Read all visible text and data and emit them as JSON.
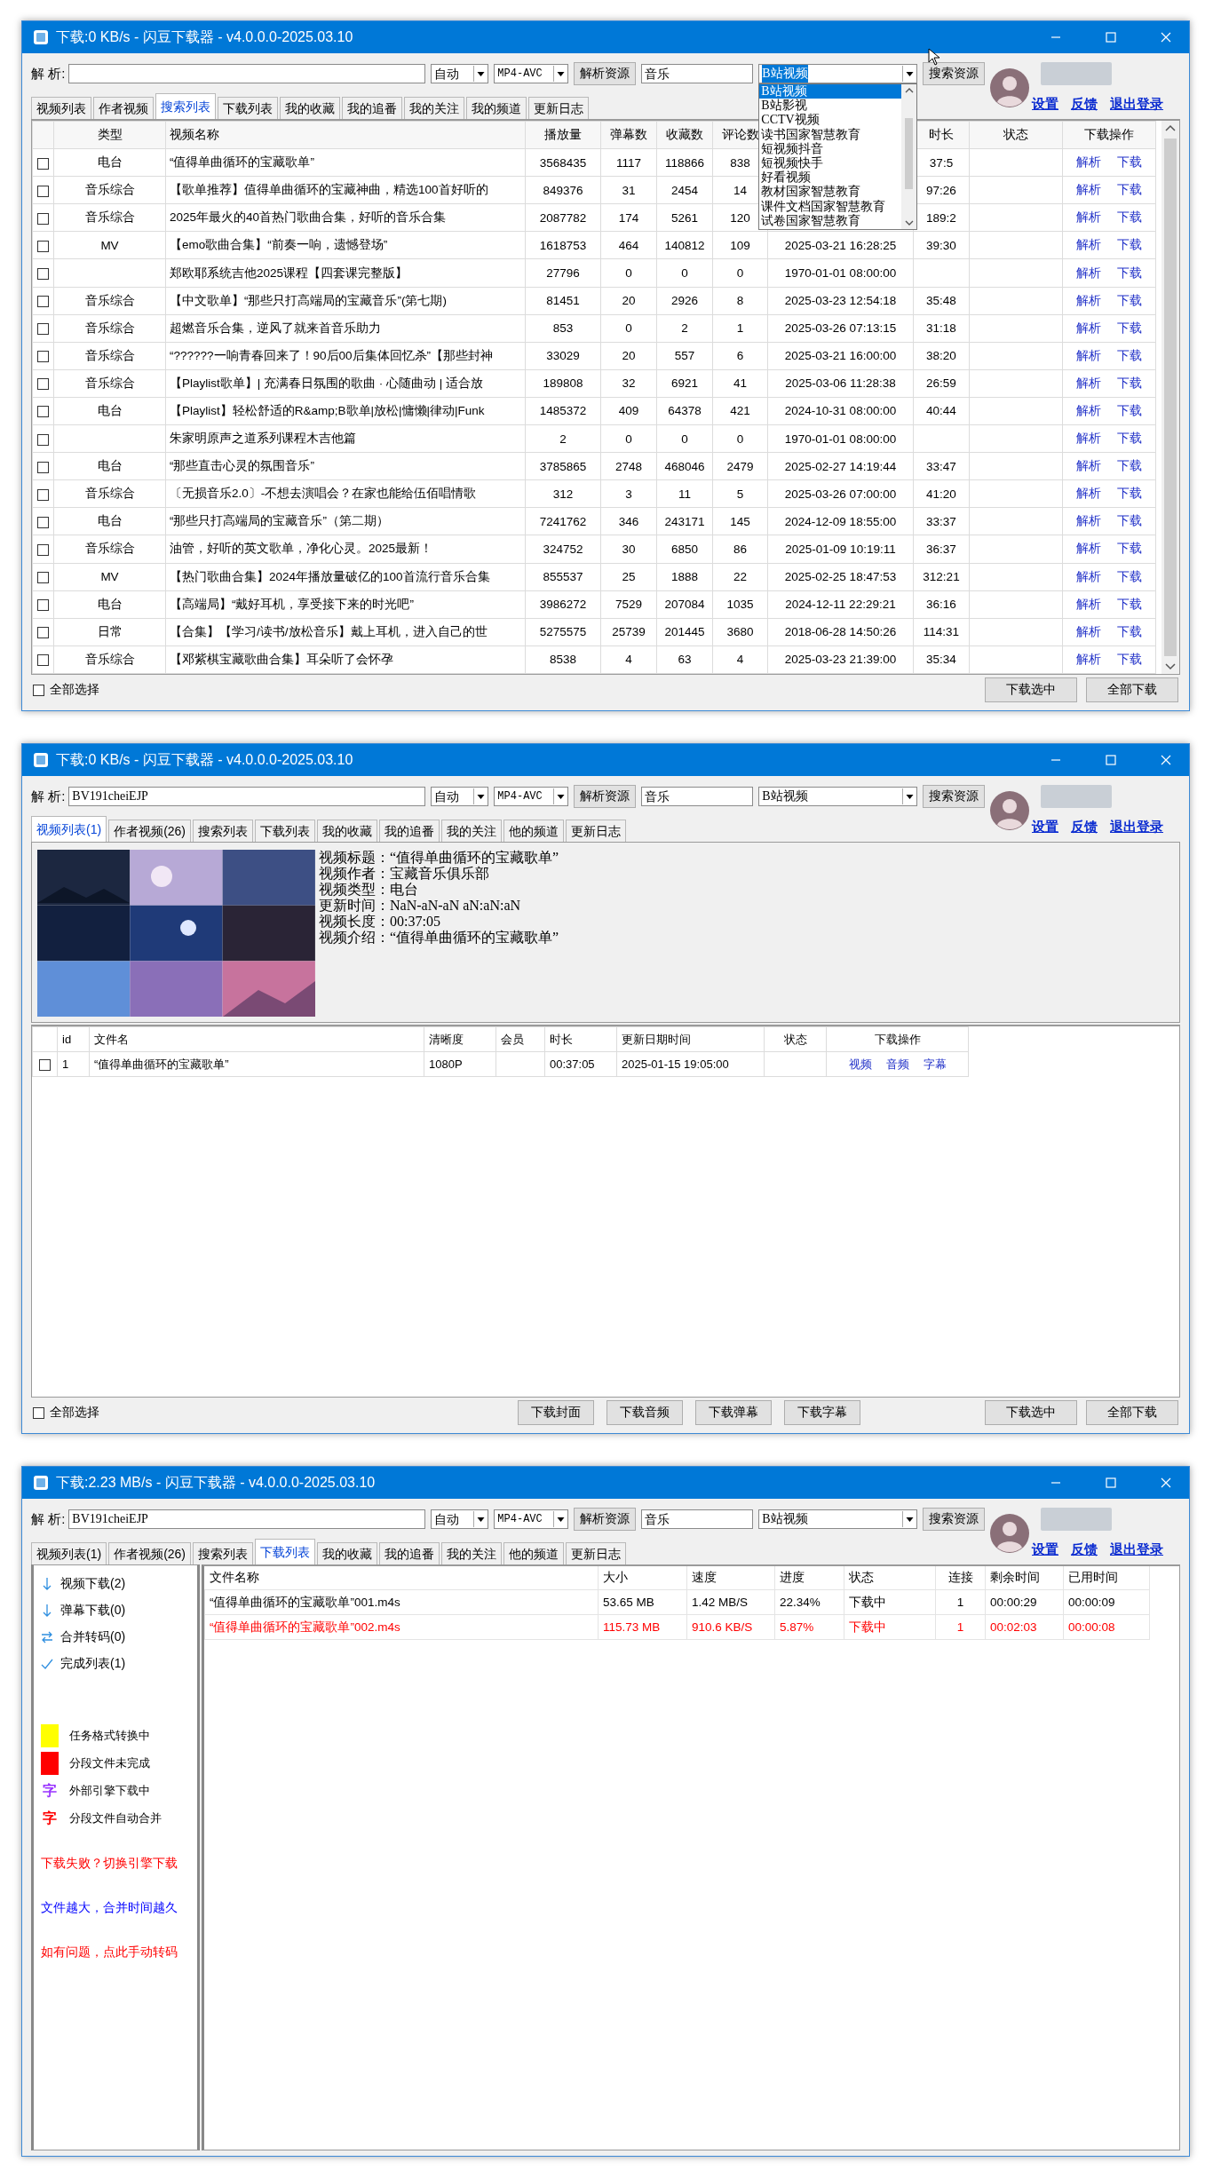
{
  "windows": [
    {
      "kind": "search",
      "title": "下载:0 KB/s - 闪豆下载器 - v4.0.0.0-2025.03.10",
      "toolbar": {
        "label": "解 析:",
        "mode": "自动",
        "format": "MP4-AVC",
        "parse_button": "解析资源",
        "keyword": "音乐",
        "site": "B站视频",
        "site_focused": true,
        "search_button": "搜索资源",
        "links": [
          "设置",
          "反馈",
          "退出登录"
        ]
      },
      "site_options": [
        {
          "label": "B站视频",
          "selected": true
        },
        {
          "label": "B站影视",
          "selected": false
        },
        {
          "label": "CCTV视频",
          "selected": false
        },
        {
          "label": "读书国家智慧教育",
          "selected": false
        },
        {
          "label": "短视频抖音",
          "selected": false
        },
        {
          "label": "短视频快手",
          "selected": false
        },
        {
          "label": "好看视频",
          "selected": false
        },
        {
          "label": "教材国家智慧教育",
          "selected": false
        },
        {
          "label": "课件文档国家智慧教育",
          "selected": false
        },
        {
          "label": "试卷国家智慧教育",
          "selected": false
        }
      ],
      "tabs": [
        {
          "label": "视频列表",
          "selected": false
        },
        {
          "label": "作者视频",
          "selected": false
        },
        {
          "label": "搜索列表",
          "selected": true
        },
        {
          "label": "下载列表",
          "selected": false
        },
        {
          "label": "我的收藏",
          "selected": false
        },
        {
          "label": "我的追番",
          "selected": false
        },
        {
          "label": "我的关注",
          "selected": false
        },
        {
          "label": "我的频道",
          "selected": false
        },
        {
          "label": "更新日志",
          "selected": false
        }
      ],
      "table": {
        "headers": {
          "type": "类型",
          "title": "视频名称",
          "plays": "播放量",
          "danmaku": "弹幕数",
          "favorites": "收藏数",
          "comments": "评论数",
          "duration": "时长",
          "status": "状态",
          "actions": "下载操作"
        },
        "rows": [
          {
            "checked": false,
            "type": "电台",
            "title": "“值得单曲循环的宝藏歌单”",
            "plays": "3568435",
            "danmaku": "1117",
            "favorites": "118866",
            "comments": "838",
            "duration": "37:5",
            "actions": [
              "解析",
              "下载"
            ]
          },
          {
            "checked": false,
            "type": "音乐综合",
            "title": "【歌单推荐】值得单曲循环的宝藏神曲，精选100首好听的",
            "plays": "849376",
            "danmaku": "31",
            "favorites": "2454",
            "comments": "14",
            "duration": "97:26",
            "actions": [
              "解析",
              "下载"
            ]
          },
          {
            "checked": false,
            "type": "音乐综合",
            "title": "2025年最火的40首热门歌曲合集，好听的音乐合集",
            "plays": "2087782",
            "danmaku": "174",
            "favorites": "5261",
            "comments": "120",
            "duration": "189:2",
            "actions": [
              "解析",
              "下载"
            ]
          },
          {
            "checked": false,
            "type": "MV",
            "title": "【emo歌曲合集】“前奏一响，遗憾登场”",
            "plays": "1618753",
            "danmaku": "464",
            "favorites": "140812",
            "comments": "109",
            "date": "2025-03-21 16:28:25",
            "duration": "39:30",
            "actions": [
              "解析",
              "下载"
            ]
          },
          {
            "checked": false,
            "title": "郑欧耶系统吉他2025课程【四套课完整版】",
            "plays": "27796",
            "danmaku": "0",
            "favorites": "0",
            "comments": "0",
            "date": "1970-01-01 08:00:00",
            "actions": [
              "解析",
              "下载"
            ]
          },
          {
            "checked": false,
            "type": "音乐综合",
            "title": "【中文歌单】“那些只打高端局的宝藏音乐”(第七期)",
            "plays": "81451",
            "danmaku": "20",
            "favorites": "2926",
            "comments": "8",
            "date": "2025-03-23 12:54:18",
            "duration": "35:48",
            "actions": [
              "解析",
              "下载"
            ]
          },
          {
            "checked": false,
            "type": "音乐综合",
            "title": "超燃音乐合集，逆风了就来首音乐助力",
            "plays": "853",
            "danmaku": "0",
            "favorites": "2",
            "comments": "1",
            "date": "2025-03-26 07:13:15",
            "duration": "31:18",
            "actions": [
              "解析",
              "下载"
            ]
          },
          {
            "checked": false,
            "type": "音乐综合",
            "title": "“??????一响青春回来了！90后00后集体回忆杀”【那些封神",
            "plays": "33029",
            "danmaku": "20",
            "favorites": "557",
            "comments": "6",
            "date": "2025-03-21 16:00:00",
            "duration": "38:20",
            "actions": [
              "解析",
              "下载"
            ]
          },
          {
            "checked": false,
            "type": "音乐综合",
            "title": "【Playlist歌单】| 充满春日氛围的歌曲 · 心随曲动 | 适合放",
            "plays": "189808",
            "danmaku": "32",
            "favorites": "6921",
            "comments": "41",
            "date": "2025-03-06 11:28:38",
            "duration": "26:59",
            "actions": [
              "解析",
              "下载"
            ]
          },
          {
            "checked": false,
            "type": "电台",
            "title": "【Playlist】轻松舒适的R&amp;B歌单|放松|慵懒|律动|Funk",
            "plays": "1485372",
            "danmaku": "409",
            "favorites": "64378",
            "comments": "421",
            "date": "2024-10-31 08:00:00",
            "duration": "40:44",
            "actions": [
              "解析",
              "下载"
            ]
          },
          {
            "checked": false,
            "title": "朱家明原声之道系列课程木吉他篇",
            "plays": "2",
            "danmaku": "0",
            "favorites": "0",
            "comments": "0",
            "date": "1970-01-01 08:00:00",
            "actions": [
              "解析",
              "下载"
            ]
          },
          {
            "checked": false,
            "type": "电台",
            "title": "“那些直击心灵的氛围音乐”",
            "plays": "3785865",
            "danmaku": "2748",
            "favorites": "468046",
            "comments": "2479",
            "date": "2025-02-27 14:19:44",
            "duration": "33:47",
            "actions": [
              "解析",
              "下载"
            ]
          },
          {
            "checked": false,
            "type": "音乐综合",
            "title": "〔无损音乐2.0〕-不想去演唱会？在家也能给伍佰唱情歌",
            "plays": "312",
            "danmaku": "3",
            "favorites": "11",
            "comments": "5",
            "date": "2025-03-26 07:00:00",
            "duration": "41:20",
            "actions": [
              "解析",
              "下载"
            ]
          },
          {
            "checked": false,
            "type": "电台",
            "title": "“那些只打高端局的宝藏音乐”（第二期）",
            "plays": "7241762",
            "danmaku": "346",
            "favorites": "243171",
            "comments": "145",
            "date": "2024-12-09 18:55:00",
            "duration": "33:37",
            "actions": [
              "解析",
              "下载"
            ]
          },
          {
            "checked": false,
            "type": "音乐综合",
            "title": "油管，好听的英文歌单，净化心灵。2025最新！",
            "plays": "324752",
            "danmaku": "30",
            "favorites": "6850",
            "comments": "86",
            "date": "2025-01-09 10:19:11",
            "duration": "36:37",
            "actions": [
              "解析",
              "下载"
            ]
          },
          {
            "checked": false,
            "type": "MV",
            "title": "【热门歌曲合集】2024年播放量破亿的100首流行音乐合集",
            "plays": "855537",
            "danmaku": "25",
            "favorites": "1888",
            "comments": "22",
            "date": "2025-02-25 18:47:53",
            "duration": "312:21",
            "actions": [
              "解析",
              "下载"
            ]
          },
          {
            "checked": false,
            "type": "电台",
            "title": "【高端局】“戴好耳机，享受接下来的时光吧”",
            "plays": "3986272",
            "danmaku": "7529",
            "favorites": "207084",
            "comments": "1035",
            "date": "2024-12-11 22:29:21",
            "duration": "36:16",
            "actions": [
              "解析",
              "下载"
            ]
          },
          {
            "checked": false,
            "type": "日常",
            "title": "【合集】【学习/读书/放松音乐】戴上耳机，进入自己的世",
            "plays": "5275575",
            "danmaku": "25739",
            "favorites": "201445",
            "comments": "3680",
            "date": "2018-06-28 14:50:26",
            "duration": "114:31",
            "actions": [
              "解析",
              "下载"
            ]
          },
          {
            "checked": false,
            "type": "音乐综合",
            "title": "【邓紫棋宝藏歌曲合集】耳朵听了会怀孕",
            "plays": "8538",
            "danmaku": "4",
            "favorites": "63",
            "comments": "4",
            "date": "2025-03-23 21:39:00",
            "duration": "35:34",
            "actions": [
              "解析",
              "下载"
            ]
          }
        ]
      },
      "select_all": {
        "label": "全部选择",
        "checked": false
      },
      "buttons": [
        "下载选中",
        "全部下载"
      ]
    },
    {
      "kind": "video",
      "title": "下载:0 KB/s - 闪豆下载器 - v4.0.0.0-2025.03.10",
      "toolbar": {
        "label": "解 析:",
        "url": "BV191cheiEJP",
        "mode": "自动",
        "format": "MP4-AVC",
        "parse_button": "解析资源",
        "keyword": "音乐",
        "site": "B站视频",
        "site_focused": false,
        "search_button": "搜索资源",
        "links": [
          "设置",
          "反馈",
          "退出登录"
        ]
      },
      "tabs": [
        {
          "label": "视频列表(1)",
          "selected": true
        },
        {
          "label": "作者视频(26)",
          "selected": false
        },
        {
          "label": "搜索列表",
          "selected": false
        },
        {
          "label": "下载列表",
          "selected": false
        },
        {
          "label": "我的收藏",
          "selected": false
        },
        {
          "label": "我的追番",
          "selected": false
        },
        {
          "label": "我的关注",
          "selected": false
        },
        {
          "label": "他的频道",
          "selected": false
        },
        {
          "label": "更新日志",
          "selected": false
        }
      ],
      "info": [
        "视频标题：“值得单曲循环的宝藏歌单”",
        "视频作者：宝藏音乐俱乐部",
        "视频类型：电台",
        "更新时间：NaN-aN-aN aN:aN:aN",
        "视频长度：00:37:05",
        "视频介绍：“值得单曲循环的宝藏歌单”"
      ],
      "table": {
        "headers": {
          "id": "id",
          "name": "文件名",
          "quality": "清晰度",
          "vip": "会员",
          "duration": "时长",
          "date": "更新日期时间",
          "status": "状态",
          "actions": "下载操作"
        },
        "rows": [
          {
            "checked": false,
            "id": "1",
            "name": "“值得单曲循环的宝藏歌单”",
            "quality": "1080P",
            "duration": "00:37:05",
            "date": "2025-01-15 19:05:00",
            "actions": [
              "视频",
              "音频",
              "字幕"
            ]
          }
        ]
      },
      "select_all": {
        "label": "全部选择",
        "checked": false
      },
      "extra_buttons": [
        "下载封面",
        "下载音频",
        "下载弹幕",
        "下载字幕"
      ],
      "buttons": [
        "下载选中",
        "全部下载"
      ]
    },
    {
      "kind": "download",
      "title": "下载:2.23 MB/s - 闪豆下载器 - v4.0.0.0-2025.03.10",
      "toolbar": {
        "label": "解 析:",
        "url": "BV191cheiEJP",
        "mode": "自动",
        "format": "MP4-AVC",
        "parse_button": "解析资源",
        "keyword": "音乐",
        "site": "B站视频",
        "site_focused": false,
        "search_button": "搜索资源",
        "links": [
          "设置",
          "反馈",
          "退出登录"
        ]
      },
      "tabs": [
        {
          "label": "视频列表(1)",
          "selected": false
        },
        {
          "label": "作者视频(26)",
          "selected": false
        },
        {
          "label": "搜索列表",
          "selected": false
        },
        {
          "label": "下载列表",
          "selected": true
        },
        {
          "label": "我的收藏",
          "selected": false
        },
        {
          "label": "我的追番",
          "selected": false
        },
        {
          "label": "我的关注",
          "selected": false
        },
        {
          "label": "他的频道",
          "selected": false
        },
        {
          "label": "更新日志",
          "selected": false
        }
      ],
      "queues": [
        {
          "kind": "down",
          "label": "视频下载(2)"
        },
        {
          "kind": "down",
          "label": "弹幕下载(0)"
        },
        {
          "kind": "merge",
          "label": "合并转码(0)"
        },
        {
          "kind": "check",
          "label": "完成列表(1)"
        }
      ],
      "legend": [
        {
          "kind": "swatch",
          "color": "#ffff00",
          "label": "任务格式转换中"
        },
        {
          "kind": "swatch",
          "color": "#ff0000",
          "label": "分段文件未完成"
        },
        {
          "kind": "glyph",
          "glyph": "字",
          "color": "#9933ff",
          "label": "外部引擎下载中"
        },
        {
          "kind": "glyph",
          "glyph": "字",
          "color": "#ff0000",
          "label": "分段文件自动合并"
        }
      ],
      "notes": [
        {
          "text": "下载失败？切换引擎下载",
          "color": "#ff0000"
        },
        {
          "text": "文件越大，合并时间越久",
          "color": "#0000ff"
        },
        {
          "text": "如有问题，点此手动转码",
          "color": "#ff0000"
        }
      ],
      "table": {
        "headers": {
          "name": "文件名称",
          "size": "大小",
          "speed": "速度",
          "progress": "进度",
          "status": "状态",
          "conn": "连接",
          "remain": "剩余时间",
          "used": "已用时间"
        },
        "rows": [
          {
            "name": "“值得单曲循环的宝藏歌单”001.m4s",
            "size": "53.65 MB",
            "speed": "1.42 MB/S",
            "progress": "22.34%",
            "status": "下载中",
            "conn": "1",
            "remain": "00:00:29",
            "used": "00:00:09",
            "color": "#000000"
          },
          {
            "name": "“值得单曲循环的宝藏歌单”002.m4s",
            "size": "115.73 MB",
            "speed": "910.6 KB/S",
            "progress": "5.87%",
            "status": "下载中",
            "conn": "1",
            "remain": "00:02:03",
            "used": "00:00:08",
            "color": "#ff0000"
          }
        ]
      }
    }
  ]
}
